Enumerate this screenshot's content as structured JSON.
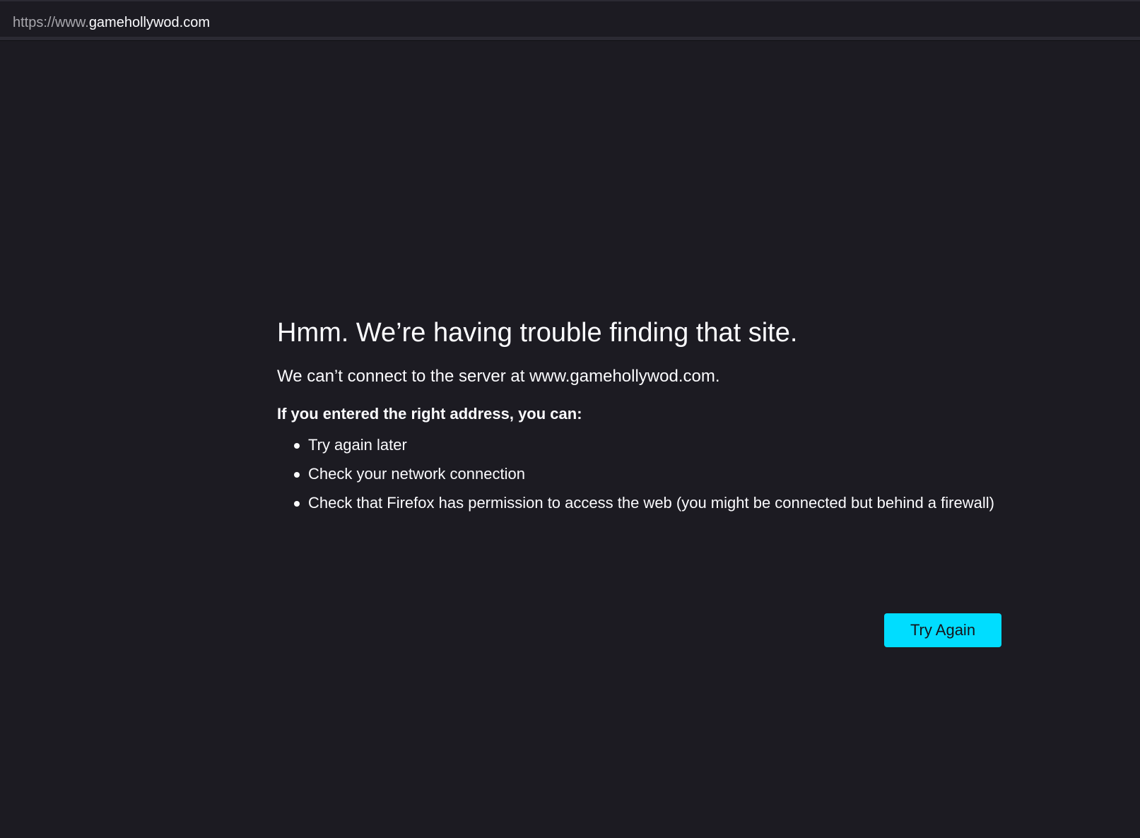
{
  "urlbar": {
    "url_prefix": "https://www.",
    "url_domain": "gamehollywod.com",
    "site_icon": "site-info-icon"
  },
  "error": {
    "title": "Hmm. We’re having trouble finding that site.",
    "description": "We can’t connect to the server at www.gamehollywod.com.",
    "subheading": "If you entered the right address, you can:",
    "suggestions": [
      "Try again later",
      "Check your network connection",
      "Check that Firefox has permission to access the web (you might be connected but behind a firewall)"
    ],
    "try_again_label": "Try Again"
  },
  "colors": {
    "background": "#1c1b22",
    "text": "#fbfbfe",
    "accent_button": "#00ddff"
  }
}
